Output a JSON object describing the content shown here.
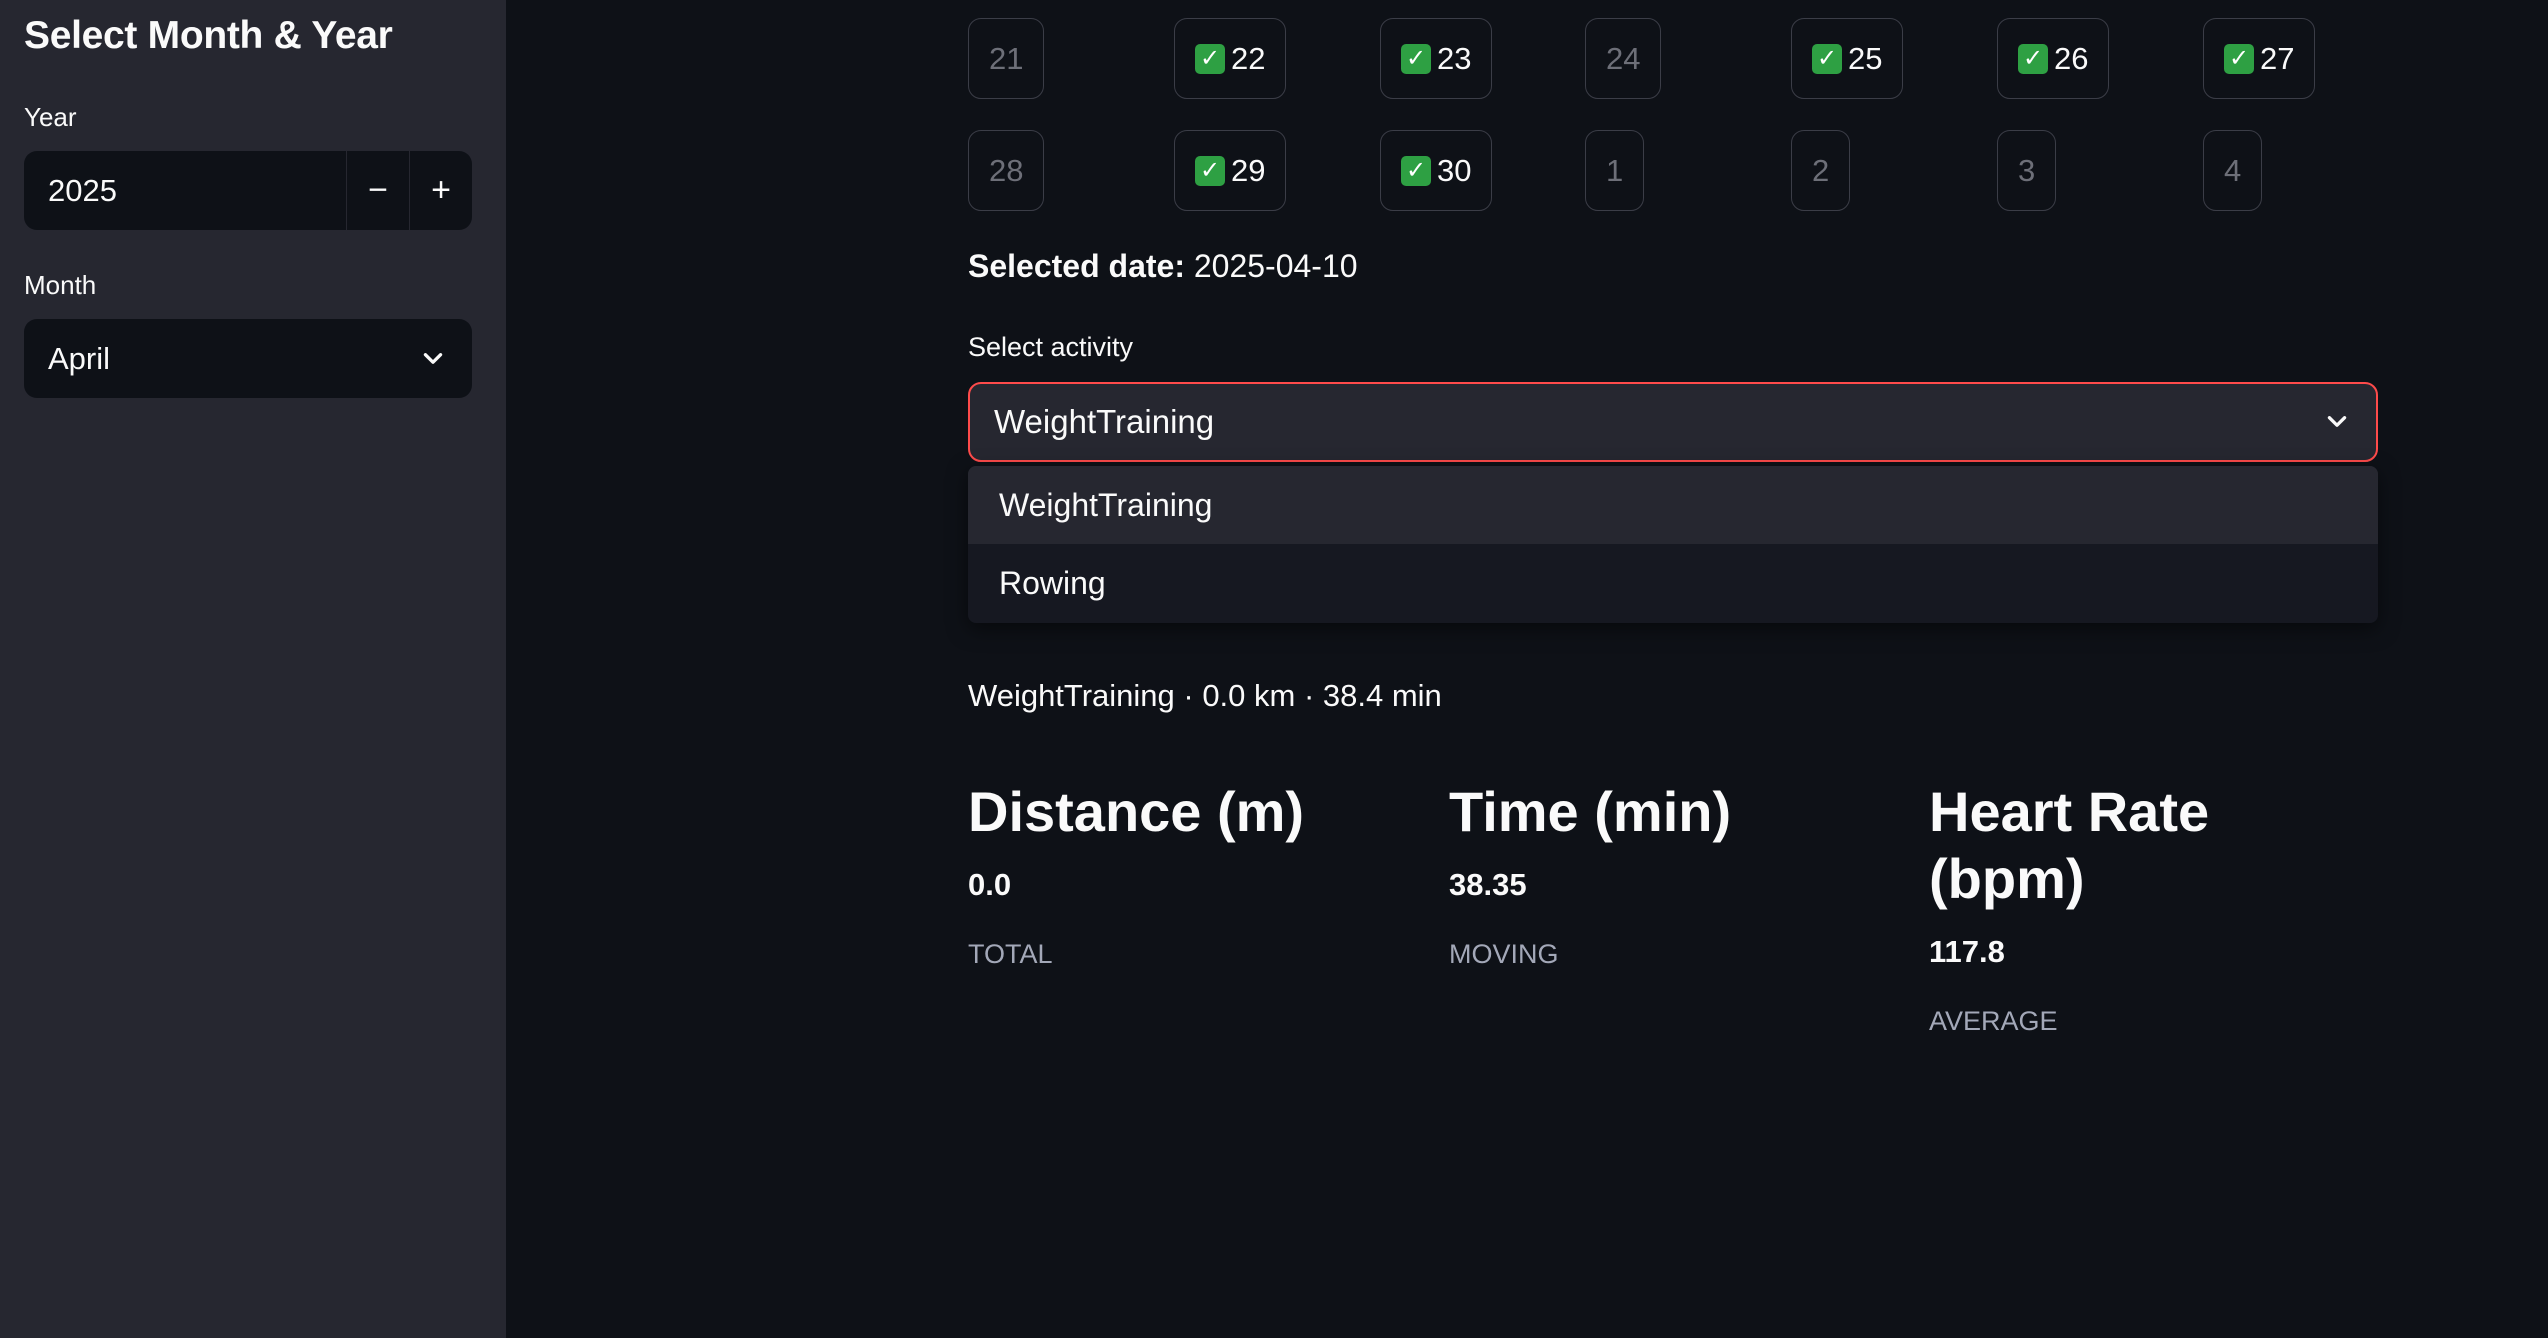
{
  "sidebar": {
    "title": "Select Month & Year",
    "year_label": "Year",
    "year_value": "2025",
    "decrement": "−",
    "increment": "+",
    "month_label": "Month",
    "month_value": "April"
  },
  "calendar": {
    "check_glyph": "✓",
    "days": [
      {
        "label": "21",
        "done": false
      },
      {
        "label": "22",
        "done": true
      },
      {
        "label": "23",
        "done": true
      },
      {
        "label": "24",
        "done": false
      },
      {
        "label": "25",
        "done": true
      },
      {
        "label": "26",
        "done": true
      },
      {
        "label": "27",
        "done": true
      },
      {
        "label": "28",
        "done": false
      },
      {
        "label": "29",
        "done": true
      },
      {
        "label": "30",
        "done": true
      },
      {
        "label": "1",
        "done": false
      },
      {
        "label": "2",
        "done": false
      },
      {
        "label": "3",
        "done": false
      },
      {
        "label": "4",
        "done": false
      }
    ]
  },
  "selected": {
    "label": "Selected date:",
    "value": "2025-04-10"
  },
  "activity": {
    "label": "Select activity",
    "value": "WeightTraining",
    "options": [
      "WeightTraining",
      "Rowing"
    ]
  },
  "summary": "WeightTraining · 0.0 km · 38.4 min",
  "metrics": [
    {
      "label": "Distance (m)",
      "value": "0.0",
      "sub": "TOTAL"
    },
    {
      "label": "Time (min)",
      "value": "38.35",
      "sub": "MOVING"
    },
    {
      "label": "Heart Rate (bpm)",
      "value": "117.8",
      "sub": "AVERAGE"
    }
  ],
  "colors": {
    "accent": "#ff4b4b",
    "check": "#2ea043",
    "sidebar_bg": "#262730",
    "main_bg": "#0e1117"
  }
}
